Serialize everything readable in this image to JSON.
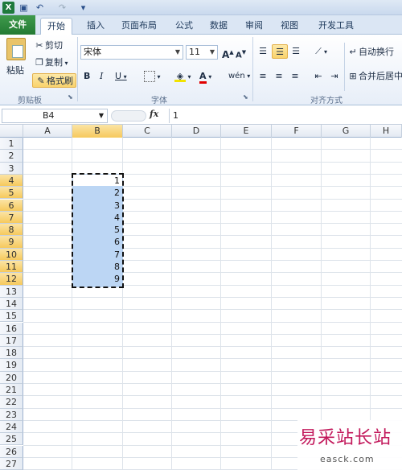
{
  "quick_access": {
    "logo": "X"
  },
  "tabs": [
    "文件",
    "开始",
    "插入",
    "页面布局",
    "公式",
    "数据",
    "审阅",
    "视图",
    "开发工具"
  ],
  "clipboard": {
    "paste": "粘贴",
    "cut": "剪切",
    "copy": "复制",
    "format_painter": "格式刷",
    "group_label": "剪贴板"
  },
  "font": {
    "name": "宋体",
    "size": "11",
    "grow": "A",
    "shrink": "A",
    "bold": "B",
    "italic": "I",
    "underline": "U",
    "font_color": "A",
    "phonetic": "wén",
    "group_label": "字体"
  },
  "alignment": {
    "wrap_text": "自动换行",
    "merge_center": "合并后居中",
    "group_label": "对齐方式"
  },
  "formula_bar": {
    "name_box": "B4",
    "fx": "fx",
    "value": "1"
  },
  "columns": [
    "A",
    "B",
    "C",
    "D",
    "E",
    "F",
    "G",
    "H"
  ],
  "rows": [
    "1",
    "2",
    "3",
    "4",
    "5",
    "6",
    "7",
    "8",
    "9",
    "10",
    "11",
    "12",
    "13",
    "14",
    "15",
    "16",
    "17",
    "18",
    "19",
    "20",
    "21",
    "22",
    "23",
    "24",
    "25",
    "26",
    "27"
  ],
  "cells_B": [
    "1",
    "2",
    "3",
    "4",
    "5",
    "6",
    "7",
    "8",
    "9"
  ],
  "watermark": {
    "brand": "易采站长站",
    "url": "easck.com"
  },
  "colors": {
    "file_tab": "#237a33",
    "selection": "#bcd6f4",
    "active_header": "#f6c95d"
  }
}
